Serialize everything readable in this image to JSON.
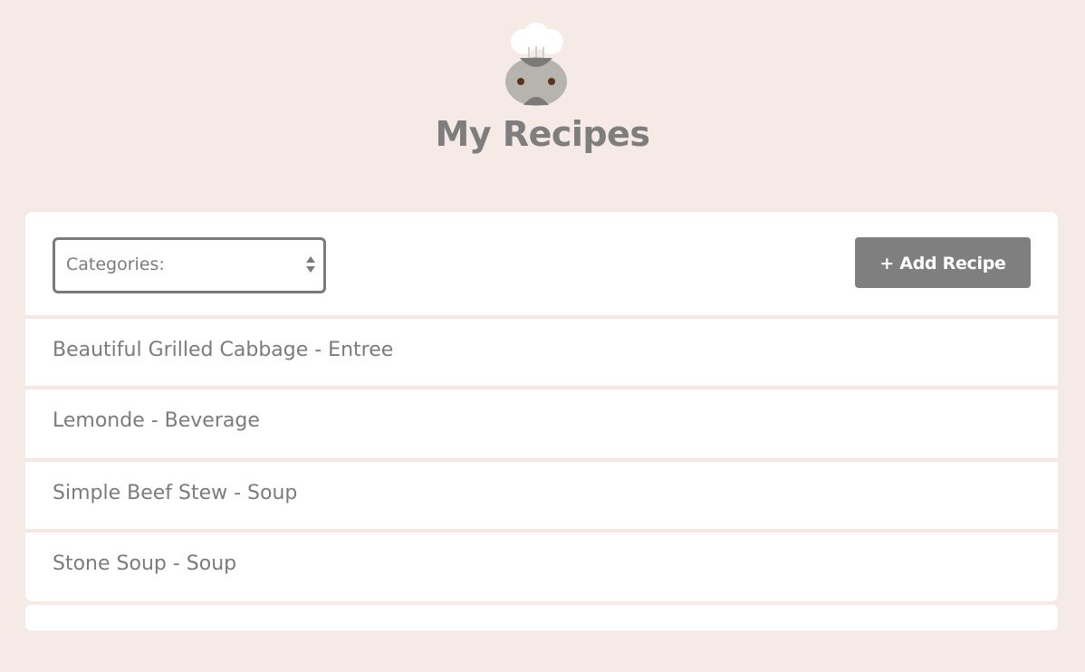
{
  "header": {
    "title": "My Recipes",
    "logo_icon": "chef-mascot-icon"
  },
  "toolbar": {
    "category_select_value": "Categories:",
    "add_button_label": "+ Add Recipe"
  },
  "recipes": [
    {
      "label": "Beautiful Grilled Cabbage - Entree"
    },
    {
      "label": "Lemonde - Beverage"
    },
    {
      "label": "Simple Beef Stew - Soup"
    },
    {
      "label": "Stone Soup - Soup"
    }
  ],
  "colors": {
    "background": "#f5eae5",
    "panel": "#ffffff",
    "button": "#7f7f7f",
    "text": "#7b7b7b"
  }
}
